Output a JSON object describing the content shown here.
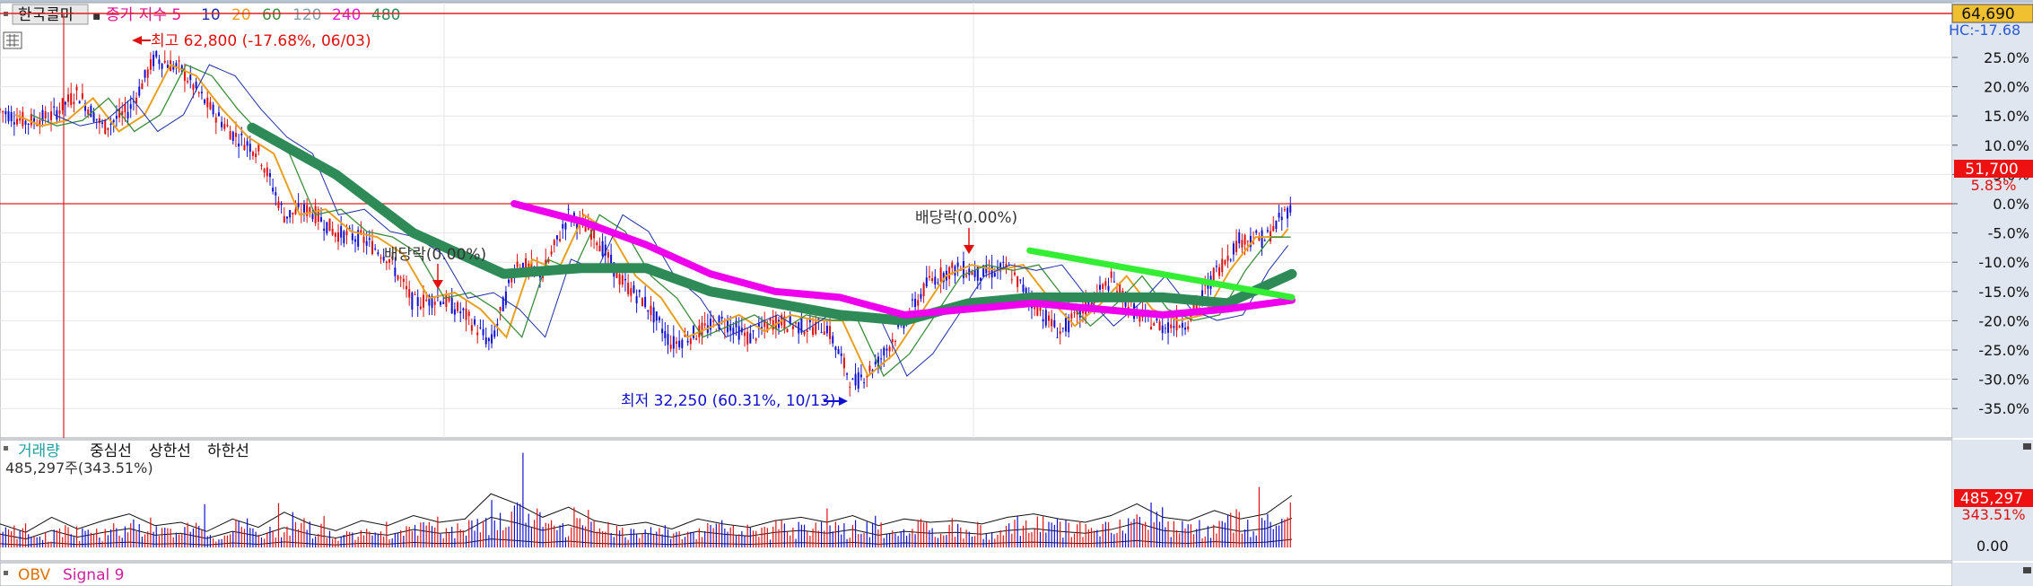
{
  "price_panel": {
    "legend": {
      "stock_name": "한국콜마",
      "ma_label": "종가 지수 5",
      "ma_periods": [
        {
          "label": "10",
          "color": "#1c2ea8"
        },
        {
          "label": "20",
          "color": "#e8a020"
        },
        {
          "label": "60",
          "color": "#3c8c3c"
        },
        {
          "label": "120",
          "color": "#7fa0b0"
        },
        {
          "label": "240",
          "color": "#e020d0"
        },
        {
          "label": "480",
          "color": "#2e8b57"
        }
      ]
    },
    "high_annotation": "최고 62,800 (-17.68%, 06/03)",
    "low_annotation": "최저 32,250 (60.31%, 10/13)",
    "dividend_labels": [
      "배당락(0.00%)",
      "배당락(0.00%)"
    ],
    "badges": {
      "top_price": "64,690",
      "hc": "HC:-17.68",
      "last_price": "51,700",
      "last_change": "5.83%"
    }
  },
  "volume_panel": {
    "legend_items": [
      "거래량",
      "중심선",
      "상한선",
      "하한선"
    ],
    "info": "485,297주(343.51%)",
    "badges": {
      "value": "485,297",
      "pct": "343.51%",
      "zero": "0.00"
    }
  },
  "obv_panel": {
    "legend_items": [
      "OBV",
      "Signal 9"
    ]
  },
  "colors": {
    "up": "#e01010",
    "down": "#1010d0",
    "ref_line": "#e02020",
    "trend_green": "#2e8b57",
    "trend_magenta": "#ee00ee",
    "trend_lime": "#33ee33",
    "badge_bg": "#ee1111",
    "badge_yellow": "#f0c030"
  },
  "chart_data": {
    "type": "line",
    "title": "한국콜마",
    "y_axis": {
      "unit": "%",
      "ylim": [
        -38,
        29
      ],
      "ticks": [
        "25.0%",
        "20.0%",
        "15.0%",
        "10.0%",
        "5.0%",
        "0.0%",
        "-5.0%",
        "-10.0%",
        "-15.0%",
        "-20.0%",
        "-25.0%",
        "-30.0%",
        "-35.0%"
      ]
    },
    "series": [
      {
        "name": "종가",
        "x": [
          0,
          20,
          40,
          60,
          80,
          100,
          120,
          140,
          160,
          180,
          200,
          220,
          240,
          260,
          280,
          300,
          320,
          340,
          360,
          380,
          400,
          420,
          440,
          460,
          480,
          500,
          520,
          540,
          560,
          580,
          600,
          620,
          640,
          660,
          680,
          700,
          720,
          740,
          760,
          780,
          800,
          820,
          840,
          860,
          880,
          900,
          920,
          940,
          960,
          980,
          1000
        ],
        "values": [
          16,
          14,
          15,
          19,
          13,
          16,
          25,
          23,
          17,
          12,
          9,
          -2,
          -1,
          -5,
          -6,
          -9,
          -17,
          -16,
          -19,
          -24,
          -10,
          -12,
          -2,
          -5,
          -13,
          -17,
          -24,
          -22,
          -20,
          -23,
          -20,
          -21,
          -21,
          -31,
          -27,
          -20,
          -13,
          -11,
          -12,
          -11,
          -17,
          -22,
          -18,
          -13,
          -19,
          -21,
          -20,
          -12,
          -6,
          -6,
          0
        ]
      },
      {
        "name": "480",
        "x": [
          195,
          260,
          320,
          390,
          450,
          500,
          550,
          600,
          650,
          700,
          750,
          800,
          850,
          900,
          950,
          1000
        ],
        "values": [
          13,
          5,
          -5,
          -12,
          -11,
          -11,
          -15,
          -17,
          -19,
          -20,
          -17,
          -16,
          -16,
          -16,
          -17,
          -12
        ]
      },
      {
        "name": "240",
        "x": [
          398,
          450,
          500,
          550,
          600,
          650,
          700,
          750,
          800,
          850,
          900,
          950,
          1000
        ],
        "values": [
          0,
          -3,
          -7,
          -12,
          -15,
          -16,
          -19,
          -18,
          -17,
          -18,
          -19,
          -18,
          -16.5
        ]
      }
    ],
    "trendlines": [
      {
        "x": [
          797,
          1000
        ],
        "values": [
          -8,
          -16
        ]
      }
    ],
    "reference_line": 0,
    "volume": {
      "bars": [
        140,
        90,
        180,
        110,
        160,
        200,
        130,
        150,
        95,
        170,
        120,
        210,
        140,
        100,
        160,
        130,
        190,
        150,
        170,
        320,
        260,
        180,
        240,
        160,
        130,
        150,
        110,
        170,
        140,
        120,
        160,
        180,
        150,
        190,
        130,
        170,
        150,
        160,
        140,
        180,
        200,
        170,
        150,
        190,
        260,
        180,
        160,
        220,
        170,
        200,
        310
      ],
      "ylim": [
        0,
        500
      ]
    }
  }
}
